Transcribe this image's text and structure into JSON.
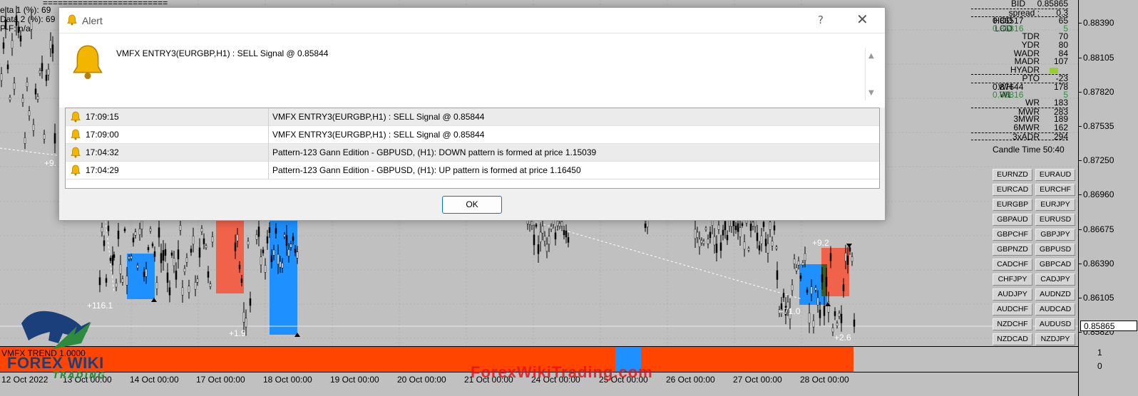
{
  "top_left_info": {
    "lines": [
      "elta 1 (%): 69",
      "Data 2 (%): 69",
      "P-F: n/a"
    ],
    "header_rule": "========================="
  },
  "stats_panel": {
    "rows": [
      {
        "label": "BID",
        "value": "0.85865",
        "extra": ""
      },
      {
        "label": "spread :",
        "value": "0.3",
        "extra": ""
      },
      {
        "label": "HOD",
        "value": "65",
        "extra": "0.86517"
      },
      {
        "label": "LOD",
        "value": "5",
        "extra": "0.85816"
      },
      {
        "label": "TDR",
        "value": "70",
        "extra": ""
      },
      {
        "label": "YDR",
        "value": "80",
        "extra": ""
      },
      {
        "label": "WADR",
        "value": "84",
        "extra": ""
      },
      {
        "label": "MADR",
        "value": "107",
        "extra": ""
      },
      {
        "label": "HYADR",
        "value": "",
        "extra": ""
      },
      {
        "label": "PTO",
        "value": "-23",
        "extra": ""
      },
      {
        "label": "WH",
        "value": "178",
        "extra": "0.87644"
      },
      {
        "label": "WL",
        "value": "5",
        "extra": "0.85816"
      },
      {
        "label": "WR",
        "value": "183",
        "extra": ""
      },
      {
        "label": "MWR",
        "value": "283",
        "extra": ""
      },
      {
        "label": "3MWR",
        "value": "189",
        "extra": ""
      },
      {
        "label": "6MWR",
        "value": "162",
        "extra": ""
      },
      {
        "label": "3xADR",
        "value": "294",
        "extra": ""
      }
    ],
    "candle_time": "Candle Time 50:40",
    "colors": {
      "accent_green": "#2e8b3d"
    }
  },
  "pair_buttons": [
    "EURNZD",
    "EURAUD",
    "EURCAD",
    "EURCHF",
    "EURGBP",
    "EURJPY",
    "GBPAUD",
    "EURUSD",
    "GBPCHF",
    "GBPJPY",
    "GBPNZD",
    "GBPUSD",
    "CADCHF",
    "GBPCAD",
    "CHFJPY",
    "CADJPY",
    "AUDJPY",
    "AUDNZD",
    "AUDCHF",
    "AUDCAD",
    "NZDCHF",
    "AUDUSD",
    "NZDCAD",
    "NZDJPY"
  ],
  "price_axis": {
    "ticks": [
      "0.88390",
      "0.88105",
      "0.87820",
      "0.87535",
      "0.87250",
      "0.86960",
      "0.86675",
      "0.86390",
      "0.86105",
      "0.85820"
    ],
    "current_price": "0.85865"
  },
  "indicator": {
    "label": "VMFX TREND  1.0000",
    "axis_top": "1",
    "axis_bottom": "0",
    "colors": {
      "sell": "#ff4500",
      "buy": "#1e90ff"
    }
  },
  "time_axis": {
    "labels": [
      "12 Oct 2022",
      "13 Oct 00:00",
      "14 Oct 00:00",
      "17 Oct 00:00",
      "18 Oct 00:00",
      "19 Oct 00:00",
      "20 Oct 00:00",
      "21 Oct 00:00",
      "24 Oct 00:00",
      "25 Oct 00:00",
      "26 Oct 00:00",
      "27 Oct 00:00",
      "28 Oct 00:00"
    ]
  },
  "chart_labels": [
    "+9.",
    "+116.1",
    "+1.9",
    "+9.2",
    "+71.0",
    "+2.6"
  ],
  "watermark": "ForexWikiTrading.com",
  "logo": {
    "main": "FOREX WIKI",
    "sub": "TRADING"
  },
  "dialog": {
    "title": "Alert",
    "help": "?",
    "close": "✕",
    "message": "VMFX ENTRY3(EURGBP,H1) : SELL Signal @ 0.85844",
    "rows": [
      {
        "time": "17:09:15",
        "message": "VMFX ENTRY3(EURGBP,H1) : SELL Signal @ 0.85844"
      },
      {
        "time": "17:09:00",
        "message": "VMFX ENTRY3(EURGBP,H1) : SELL Signal @ 0.85844"
      },
      {
        "time": "17:04:32",
        "message": "Pattern-123 Gann Edition - GBPUSD, (H1): DOWN pattern is formed at price 1.15039"
      },
      {
        "time": "17:04:29",
        "message": "Pattern-123 Gann Edition - GBPUSD, (H1): UP pattern is formed at price 1.16450"
      }
    ],
    "ok_label": "OK"
  }
}
